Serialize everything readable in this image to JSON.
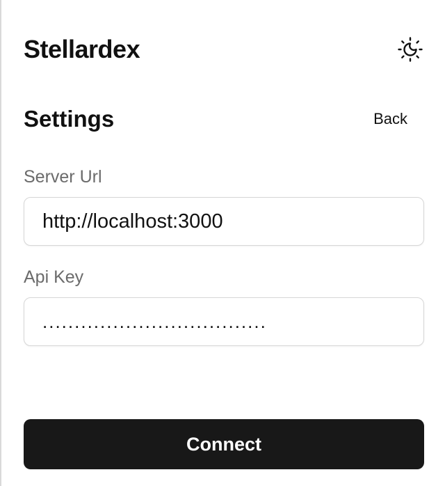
{
  "header": {
    "app_title": "Stellardex",
    "theme_toggle_icon": "sun-moon-icon"
  },
  "settings": {
    "title": "Settings",
    "back_label": "Back"
  },
  "form": {
    "server_url": {
      "label": "Server Url",
      "value": "http://localhost:3000"
    },
    "api_key": {
      "label": "Api Key",
      "value": "..................................."
    },
    "connect_label": "Connect"
  },
  "colors": {
    "primary_button": "#181818",
    "label_text": "#6b6b6b",
    "input_border": "#d6d6d6"
  }
}
